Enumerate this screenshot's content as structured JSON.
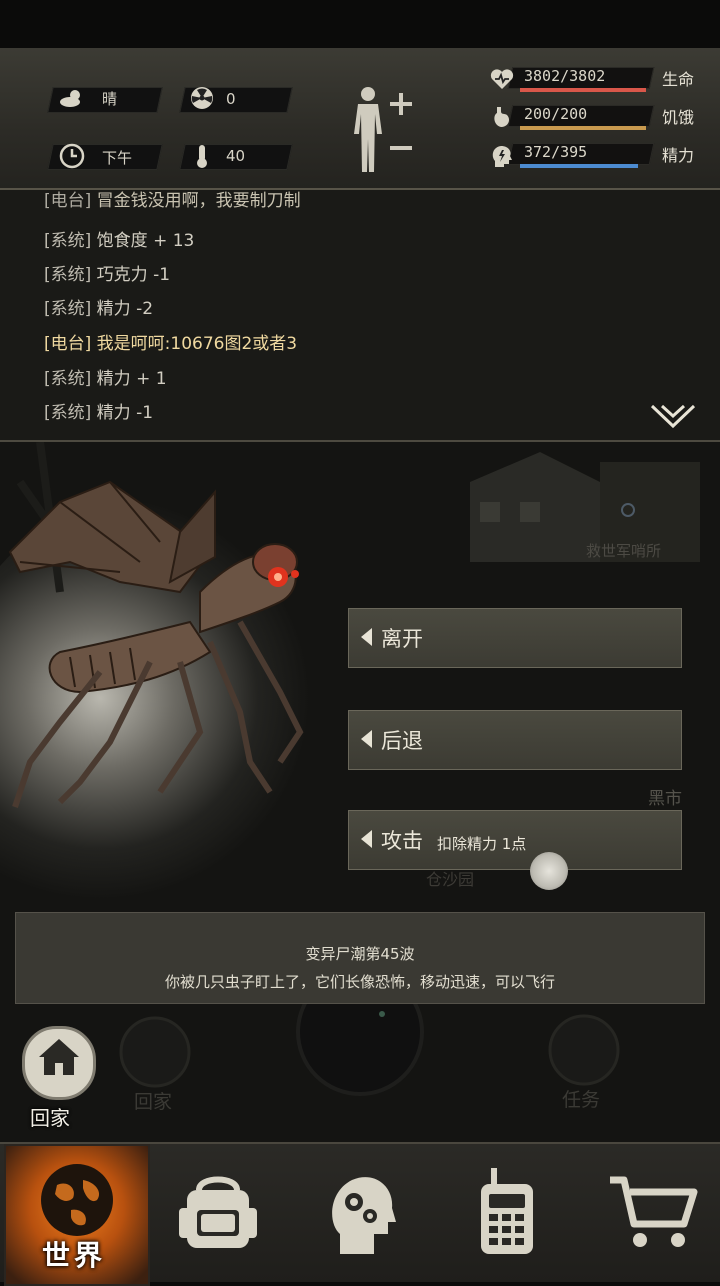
{
  "status": {
    "weather": {
      "icon": "cloud-sun-icon",
      "label": "晴"
    },
    "radiation": {
      "icon": "radiation-icon",
      "value": "0"
    },
    "time": {
      "icon": "clock-icon",
      "label": "下午"
    },
    "temperature": {
      "icon": "thermometer-icon",
      "value": "40"
    },
    "body_icon": "body-figure-icon",
    "stats": [
      {
        "icon": "heart-icon",
        "value": "3802/3802",
        "label": "生命",
        "fill": 1.0,
        "color": "#d9574a"
      },
      {
        "icon": "stomach-icon",
        "value": "200/200",
        "label": "饥饿",
        "fill": 1.0,
        "color": "#c99a4f"
      },
      {
        "icon": "energy-head-icon",
        "value": "372/395",
        "label": "精力",
        "fill": 0.94,
        "color": "#4c8bd0"
      }
    ]
  },
  "log": {
    "lines": [
      {
        "tag": "[电台]",
        "text": "冒金钱没用啊，我要制刀制",
        "type": "radio-partial"
      },
      {
        "tag": "[系统]",
        "text": "饱食度 + 13",
        "type": "system"
      },
      {
        "tag": "[系统]",
        "text": "巧克力 -1",
        "type": "system"
      },
      {
        "tag": "[系统]",
        "text": "精力 -2",
        "type": "system"
      },
      {
        "tag": "[电台]",
        "text": "我是呵呵:10676图2或者3",
        "type": "radio"
      },
      {
        "tag": "[系统]",
        "text": "精力 + 1",
        "type": "system"
      },
      {
        "tag": "[系统]",
        "text": "精力 -1",
        "type": "system"
      }
    ],
    "collapse_icon": "chevron-down-icon"
  },
  "map": {
    "location_label": "救世军哨所",
    "blackmarket_label": "黑市",
    "faded_label": "仓沙园",
    "home_label": "回家",
    "task_label": "任务"
  },
  "actions": [
    {
      "label": "离开",
      "sub": ""
    },
    {
      "label": "后退",
      "sub": ""
    },
    {
      "label": "攻击",
      "sub": "扣除精力 1点"
    }
  ],
  "event": {
    "title": "变异尸潮第45波",
    "text": "你被几只虫子盯上了，它们长像恐怖，移动迅速，可以飞行"
  },
  "home_button": {
    "label": "回家",
    "icon": "house-icon"
  },
  "nav": [
    {
      "label": "世界",
      "icon": "globe-icon",
      "active": true
    },
    {
      "label": "",
      "icon": "backpack-icon"
    },
    {
      "label": "",
      "icon": "brain-gears-icon"
    },
    {
      "label": "",
      "icon": "walkie-talkie-icon"
    },
    {
      "label": "",
      "icon": "shopping-cart-icon"
    }
  ]
}
